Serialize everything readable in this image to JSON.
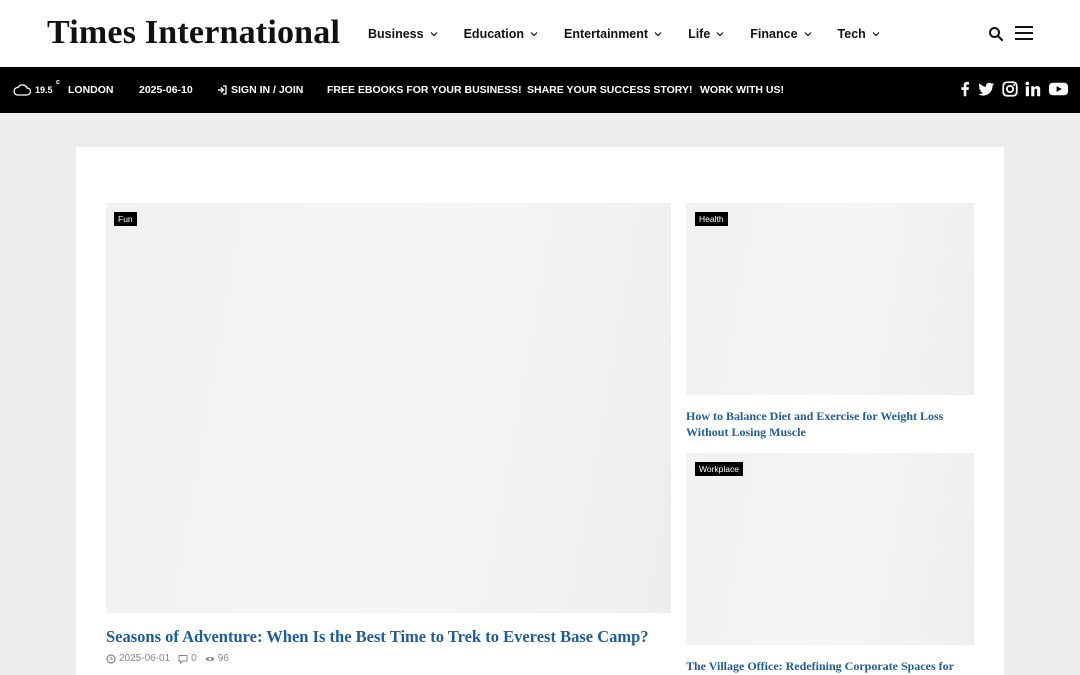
{
  "header": {
    "logo": "Times International",
    "nav": [
      {
        "label": "Business"
      },
      {
        "label": "Education"
      },
      {
        "label": "Entertainment"
      },
      {
        "label": "Life"
      },
      {
        "label": "Finance"
      },
      {
        "label": "Tech"
      }
    ]
  },
  "topbar": {
    "temperature": "19.5",
    "temp_unit": "c",
    "city": "LONDON",
    "date": "2025-06-10",
    "sign_in": "SIGN IN / JOIN",
    "links": [
      "FREE EBOOKS FOR YOUR BUSINESS!",
      "SHARE YOUR SUCCESS STORY!",
      "WORK WITH US!"
    ],
    "social": [
      "facebook-icon",
      "twitter-icon",
      "instagram-icon",
      "linkedin-icon",
      "youtube-icon"
    ]
  },
  "featured": {
    "category": "Fun",
    "title": "Seasons of Adventure: When Is the Best Time to Trek to Everest Base Camp?",
    "date": "2025-06-01",
    "comments": "0",
    "views": "96"
  },
  "side_posts": [
    {
      "category": "Health",
      "title": "How to Balance Diet and Exercise for Weight Loss Without Losing Muscle"
    },
    {
      "category": "Workplace",
      "title": "The Village Office: Redefining Corporate Spaces for"
    }
  ],
  "colors": {
    "title_link": "#1b5e9a",
    "topbar_bg": "#000000",
    "page_bg": "#ededed"
  }
}
